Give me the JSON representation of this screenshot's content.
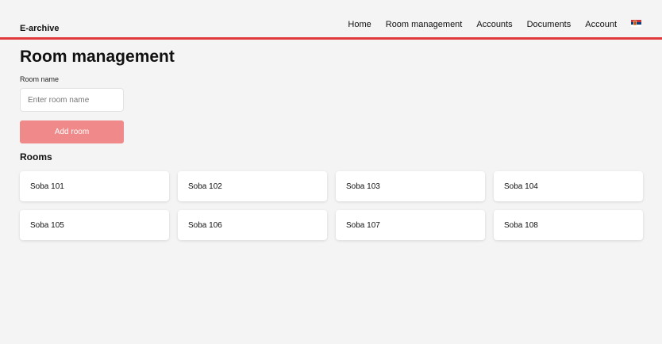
{
  "navbar": {
    "brand": "E-archive",
    "links": [
      "Home",
      "Room management",
      "Accounts",
      "Documents",
      "Account"
    ],
    "language_flag_icon": "serbian-flag-icon",
    "accent_color": "#e0383b"
  },
  "page": {
    "title": "Room management"
  },
  "form": {
    "room_name_label": "Room name",
    "room_name_placeholder": "Enter room name",
    "room_name_value": "",
    "add_button_label": "Add room",
    "add_button_color": "#f08a8a"
  },
  "rooms_section": {
    "title": "Rooms",
    "rooms": [
      "Soba 101",
      "Soba 102",
      "Soba 103",
      "Soba 104",
      "Soba 105",
      "Soba 106",
      "Soba 107",
      "Soba 108"
    ]
  }
}
